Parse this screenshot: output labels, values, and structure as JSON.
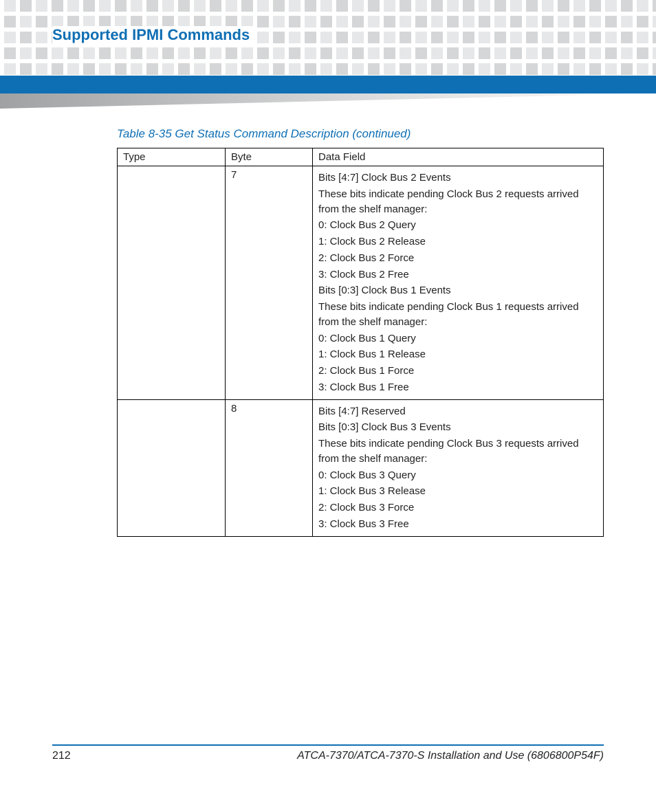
{
  "header": {
    "title": "Supported IPMI Commands"
  },
  "table": {
    "caption": "Table 8-35 Get Status Command Description (continued)",
    "columns": [
      "Type",
      "Byte",
      "Data Field"
    ],
    "rows": [
      {
        "type": "",
        "byte": "7",
        "data": [
          "Bits [4:7] Clock Bus 2 Events",
          "These bits indicate pending Clock Bus 2 requests arrived from the shelf manager:",
          "0: Clock Bus 2 Query",
          "1: Clock Bus 2 Release",
          "2: Clock Bus 2 Force",
          "3: Clock Bus 2 Free",
          "Bits [0:3] Clock Bus 1 Events",
          "These bits indicate pending Clock Bus 1 requests arrived from the shelf manager:",
          "0: Clock Bus 1 Query",
          "1: Clock Bus 1 Release",
          "2: Clock Bus 1 Force",
          "3: Clock Bus 1 Free"
        ]
      },
      {
        "type": "",
        "byte": "8",
        "data": [
          "Bits [4:7] Reserved",
          "Bits [0:3] Clock Bus 3 Events",
          "These bits indicate pending Clock Bus 3 requests arrived from the shelf manager:",
          "0: Clock Bus 3 Query",
          "1: Clock Bus 3 Release",
          "2: Clock Bus 3 Force",
          "3: Clock Bus 3 Free"
        ]
      }
    ]
  },
  "footer": {
    "page": "212",
    "doc": "ATCA-7370/ATCA-7370-S Installation and Use (6806800P54F)"
  }
}
